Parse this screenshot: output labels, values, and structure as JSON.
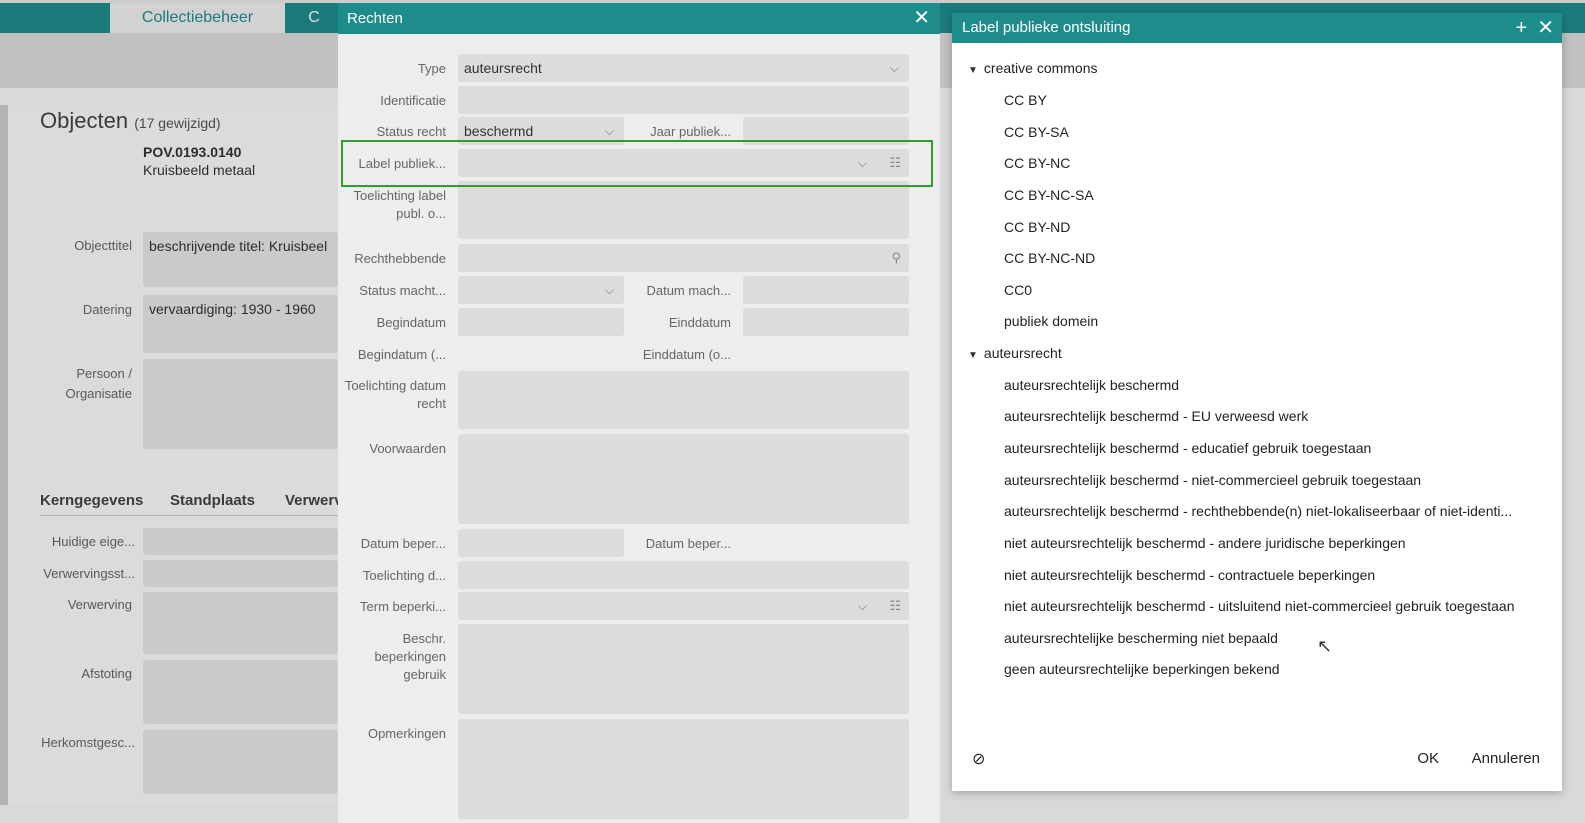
{
  "app": {
    "tabs": [
      "Collectiebeheer",
      "C"
    ],
    "object": {
      "title": "Objecten",
      "changed": "(17 gewijzigd)",
      "number": "POV.0193.0140",
      "name": "Kruisbeeld metaal"
    },
    "fields": [
      {
        "label": "Objecttitel",
        "value": "beschrijvende titel: Kruisbeel"
      },
      {
        "label": "Datering",
        "value": "vervaardiging: 1930 - 1960"
      },
      {
        "label": "Persoon / Organisatie",
        "value": ""
      }
    ],
    "section_tabs": [
      "Kerngegevens",
      "Standplaats",
      "Verwerv"
    ],
    "section_fields": [
      "Huidige eige...",
      "Verwervingsst...",
      "Verwerving",
      "Afstoting",
      "Herkomstgesc..."
    ]
  },
  "rechten": {
    "title": "Rechten",
    "close": "✕",
    "labels": {
      "type": "Type",
      "identificatie": "Identificatie",
      "status_recht": "Status recht",
      "jaar_publiek": "Jaar publiek...",
      "label_publiek": "Label publiek...",
      "toelichting_label": "Toelichting label publ. o...",
      "rechthebbende": "Rechthebbende",
      "status_macht": "Status macht...",
      "datum_mach": "Datum mach...",
      "begindatum": "Begindatum",
      "einddatum": "Einddatum",
      "begindatum2": "Begindatum (...",
      "einddatum2": "Einddatum (o...",
      "toelichting_datum": "Toelichting datum recht",
      "voorwaarden": "Voorwaarden",
      "datum_beper1": "Datum beper...",
      "datum_beper2": "Datum beper...",
      "toelichting_d": "Toelichting d...",
      "term_beperki": "Term beperki...",
      "beschr": "Beschr. beperkingen gebruik",
      "opmerkingen": "Opmerkingen"
    },
    "values": {
      "type": "auteursrecht",
      "status_recht": "beschermd"
    }
  },
  "lpo": {
    "title": "Label publieke ontsluiting",
    "add": "+",
    "close": "✕",
    "groups": [
      {
        "label": "creative commons",
        "items": [
          "CC BY",
          "CC BY-SA",
          "CC BY-NC",
          "CC BY-NC-SA",
          "CC BY-ND",
          "CC BY-NC-ND",
          "CC0",
          "publiek domein"
        ]
      },
      {
        "label": "auteursrecht",
        "items": [
          "auteursrechtelijk beschermd",
          "auteursrechtelijk beschermd - EU verweesd werk",
          "auteursrechtelijk beschermd - educatief gebruik toegestaan",
          "auteursrechtelijk beschermd - niet-commercieel gebruik toegestaan",
          "auteursrechtelijk beschermd - rechthebbende(n) niet-lokaliseerbaar of niet-identi...",
          "niet auteursrechtelijk beschermd - andere juridische beperkingen",
          "niet auteursrechtelijk beschermd - contractuele beperkingen",
          "niet auteursrechtelijk beschermd - uitsluitend niet-commercieel gebruik toegestaan",
          "auteursrechtelijke bescherming niet bepaald",
          "geen auteursrechtelijke beperkingen bekend"
        ]
      }
    ],
    "ok": "OK",
    "cancel": "Annuleren",
    "clear_icon": "⊘"
  }
}
